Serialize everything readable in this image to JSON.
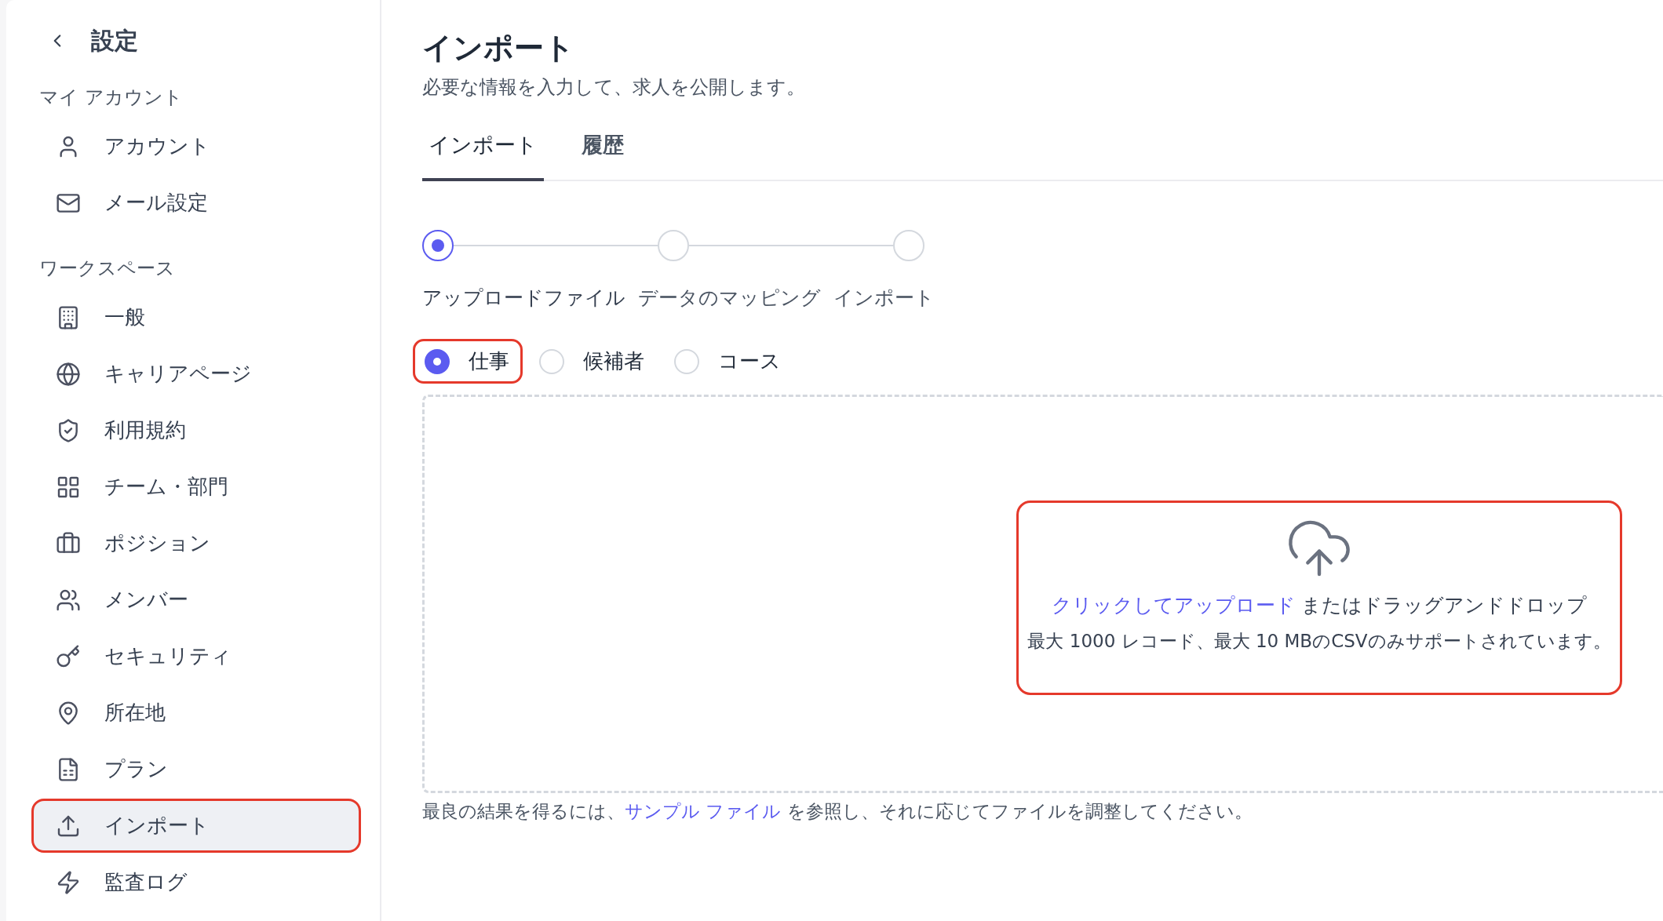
{
  "sidebar": {
    "back_label": "設定",
    "sections": [
      {
        "title": "マイ アカウント",
        "items": [
          {
            "label": "アカウント",
            "selected": false,
            "highlighted": false
          },
          {
            "label": "メール設定",
            "selected": false,
            "highlighted": false
          }
        ]
      },
      {
        "title": "ワークスペース",
        "items": [
          {
            "label": "一般",
            "selected": false,
            "highlighted": false
          },
          {
            "label": "キャリアページ",
            "selected": false,
            "highlighted": false
          },
          {
            "label": "利用規約",
            "selected": false,
            "highlighted": false
          },
          {
            "label": "チーム・部門",
            "selected": false,
            "highlighted": false
          },
          {
            "label": "ポジション",
            "selected": false,
            "highlighted": false
          },
          {
            "label": "メンバー",
            "selected": false,
            "highlighted": false
          },
          {
            "label": "セキュリティ",
            "selected": false,
            "highlighted": false
          },
          {
            "label": "所在地",
            "selected": false,
            "highlighted": false
          },
          {
            "label": "プラン",
            "selected": false,
            "highlighted": false
          },
          {
            "label": "インポート",
            "selected": true,
            "highlighted": true
          },
          {
            "label": "監査ログ",
            "selected": false,
            "highlighted": false
          }
        ]
      }
    ]
  },
  "page": {
    "title": "インポート",
    "subtitle": "必要な情報を入力して、求人を公開します。"
  },
  "tabs": [
    {
      "label": "インポート",
      "selected": true
    },
    {
      "label": "履歴",
      "selected": false
    }
  ],
  "steps": [
    {
      "label": "アップロードファイル",
      "current": true
    },
    {
      "label": "データのマッピング",
      "current": false
    },
    {
      "label": "インポート",
      "current": false
    }
  ],
  "record_types": [
    {
      "label": "仕事",
      "selected": true,
      "highlighted": true
    },
    {
      "label": "候補者",
      "selected": false,
      "highlighted": false
    },
    {
      "label": "コース",
      "selected": false,
      "highlighted": false
    }
  ],
  "upload": {
    "link": "クリックしてアップロード",
    "text": " またはドラッグアンドドロップ",
    "note": "最大 1000 レコード、最大 10 MBのCSVのみサポートされています。",
    "highlighted": true
  },
  "footer": {
    "before": "最良の結果を得るには、",
    "link": "サンプル ファイル",
    "after": " を参照し、それに応じてファイルを調整してください。"
  }
}
